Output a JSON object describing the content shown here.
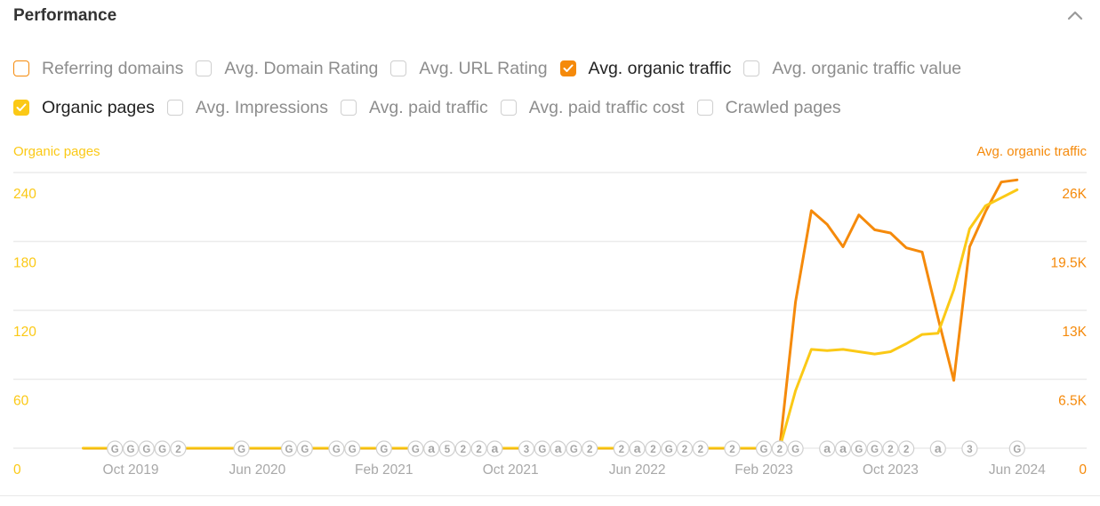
{
  "header": {
    "title": "Performance",
    "collapse_icon": "chevron-up-icon"
  },
  "metrics": [
    {
      "label": "Referring domains",
      "checked": false,
      "color": "#f58a0b"
    },
    {
      "label": "Avg. Domain Rating",
      "checked": false,
      "color": ""
    },
    {
      "label": "Avg. URL Rating",
      "checked": false,
      "color": ""
    },
    {
      "label": "Avg. organic traffic",
      "checked": true,
      "color": "#f58a0b"
    },
    {
      "label": "Avg. organic traffic value",
      "checked": false,
      "color": ""
    },
    {
      "label": "Organic pages",
      "checked": true,
      "color": "#fbc916"
    },
    {
      "label": "Avg. Impressions",
      "checked": false,
      "color": ""
    },
    {
      "label": "Avg. paid traffic",
      "checked": false,
      "color": ""
    },
    {
      "label": "Avg. paid traffic cost",
      "checked": false,
      "color": ""
    },
    {
      "label": "Crawled pages",
      "checked": false,
      "color": ""
    }
  ],
  "chart_data": {
    "type": "line",
    "title": "",
    "x_unit": "month",
    "x_start": "2019-07",
    "x_end": "2024-06",
    "x_ticks": [
      "Oct 2019",
      "Jun 2020",
      "Feb 2021",
      "Oct 2021",
      "Jun 2022",
      "Feb 2023",
      "Oct 2023",
      "Jun 2024"
    ],
    "x_tick_months": [
      "2019-10",
      "2020-06",
      "2021-02",
      "2021-10",
      "2022-06",
      "2023-02",
      "2023-10",
      "2024-06"
    ],
    "grid": true,
    "left_axis": {
      "label": "Organic pages",
      "color": "#fbc916",
      "ticks": [
        "0",
        "60",
        "120",
        "180",
        "240"
      ],
      "range": [
        0,
        240
      ]
    },
    "right_axis": {
      "label": "Avg. organic traffic",
      "color": "#f58a0b",
      "ticks": [
        "0",
        "6.5K",
        "13K",
        "19.5K",
        "26K"
      ],
      "range": [
        0,
        26000
      ]
    },
    "series": [
      {
        "name": "Organic pages",
        "axis": "left",
        "color": "#fbc916",
        "points": [
          [
            "2019-07",
            0
          ],
          [
            "2023-03",
            0
          ],
          [
            "2023-04",
            50
          ],
          [
            "2023-05",
            86
          ],
          [
            "2023-06",
            85
          ],
          [
            "2023-07",
            86
          ],
          [
            "2023-08",
            84
          ],
          [
            "2023-09",
            82
          ],
          [
            "2023-10",
            84
          ],
          [
            "2023-11",
            91
          ],
          [
            "2023-12",
            99
          ],
          [
            "2024-01",
            100
          ],
          [
            "2024-02",
            138
          ],
          [
            "2024-03",
            191
          ],
          [
            "2024-04",
            211
          ],
          [
            "2024-05",
            218
          ],
          [
            "2024-06",
            225
          ]
        ]
      },
      {
        "name": "Avg. organic traffic",
        "axis": "right",
        "color": "#f58a0b",
        "points": [
          [
            "2019-07",
            0
          ],
          [
            "2023-03",
            0
          ],
          [
            "2023-04",
            13800
          ],
          [
            "2023-05",
            22400
          ],
          [
            "2023-06",
            21100
          ],
          [
            "2023-07",
            19000
          ],
          [
            "2023-08",
            22000
          ],
          [
            "2023-09",
            20600
          ],
          [
            "2023-10",
            20300
          ],
          [
            "2023-11",
            18900
          ],
          [
            "2023-12",
            18500
          ],
          [
            "2024-01",
            12300
          ],
          [
            "2024-02",
            6400
          ],
          [
            "2024-03",
            19000
          ],
          [
            "2024-04",
            22300
          ],
          [
            "2024-05",
            25100
          ],
          [
            "2024-06",
            25300
          ]
        ]
      }
    ],
    "annotations": [
      {
        "month": "2019-09",
        "label": "G"
      },
      {
        "month": "2019-10",
        "label": "G"
      },
      {
        "month": "2019-11",
        "label": "G"
      },
      {
        "month": "2019-12",
        "label": "G"
      },
      {
        "month": "2020-01",
        "label": "2"
      },
      {
        "month": "2020-05",
        "label": "G"
      },
      {
        "month": "2020-08",
        "label": "G"
      },
      {
        "month": "2020-09",
        "label": "G"
      },
      {
        "month": "2020-11",
        "label": "G"
      },
      {
        "month": "2020-12",
        "label": "G"
      },
      {
        "month": "2021-02",
        "label": "G"
      },
      {
        "month": "2021-04",
        "label": "G"
      },
      {
        "month": "2021-05",
        "label": "a"
      },
      {
        "month": "2021-06",
        "label": "5"
      },
      {
        "month": "2021-07",
        "label": "2"
      },
      {
        "month": "2021-08",
        "label": "2"
      },
      {
        "month": "2021-09",
        "label": "a"
      },
      {
        "month": "2021-11",
        "label": "3"
      },
      {
        "month": "2021-12",
        "label": "G"
      },
      {
        "month": "2022-01",
        "label": "a"
      },
      {
        "month": "2022-02",
        "label": "G"
      },
      {
        "month": "2022-03",
        "label": "2"
      },
      {
        "month": "2022-05",
        "label": "2"
      },
      {
        "month": "2022-06",
        "label": "a"
      },
      {
        "month": "2022-07",
        "label": "2"
      },
      {
        "month": "2022-08",
        "label": "G"
      },
      {
        "month": "2022-09",
        "label": "2"
      },
      {
        "month": "2022-10",
        "label": "2"
      },
      {
        "month": "2022-12",
        "label": "2"
      },
      {
        "month": "2023-02",
        "label": "G"
      },
      {
        "month": "2023-03",
        "label": "2"
      },
      {
        "month": "2023-04",
        "label": "G"
      },
      {
        "month": "2023-06",
        "label": "a"
      },
      {
        "month": "2023-07",
        "label": "a"
      },
      {
        "month": "2023-08",
        "label": "G"
      },
      {
        "month": "2023-09",
        "label": "G"
      },
      {
        "month": "2023-10",
        "label": "2"
      },
      {
        "month": "2023-11",
        "label": "2"
      },
      {
        "month": "2024-01",
        "label": "a"
      },
      {
        "month": "2024-03",
        "label": "3"
      },
      {
        "month": "2024-06",
        "label": "G"
      }
    ]
  }
}
